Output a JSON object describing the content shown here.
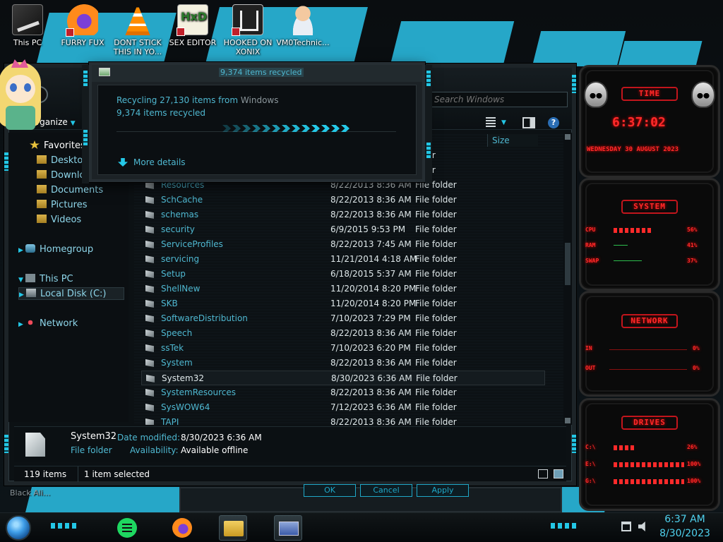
{
  "desktop": {
    "icons": [
      {
        "label": "This PC",
        "icon": "this-pc-icon"
      },
      {
        "label": "FURRY FUX",
        "icon": "firefox-icon"
      },
      {
        "label": "DONT STICK THIS IN YO...",
        "icon": "vlc-cone-icon"
      },
      {
        "label": "SEX EDITOR",
        "icon": "hxd-editor-icon"
      },
      {
        "label": "HOOKED ON XONIX",
        "icon": "game-icon"
      },
      {
        "label": "VM0Technic...",
        "icon": "doctor-avatar-icon"
      }
    ],
    "background_label": "Black Ali..."
  },
  "explorer": {
    "search_placeholder": "Search Windows",
    "organize_label": "Organize",
    "column_size_label": "Size",
    "nav": {
      "favorites": "Favorites",
      "desktop": "Desktop",
      "downloads": "Downloa...",
      "documents": "Documents",
      "pictures": "Pictures",
      "videos": "Videos",
      "homegroup": "Homegroup",
      "this_pc": "This PC",
      "local_disk": "Local Disk (C:)",
      "network": "Network"
    },
    "partial_rows": [
      "folder",
      "folder"
    ],
    "files": [
      {
        "name": "Resources",
        "date": "8/22/2013 8:36 AM",
        "type": "File folder"
      },
      {
        "name": "SchCache",
        "date": "8/22/2013 8:36 AM",
        "type": "File folder"
      },
      {
        "name": "schemas",
        "date": "8/22/2013 8:36 AM",
        "type": "File folder"
      },
      {
        "name": "security",
        "date": "6/9/2015 9:53 PM",
        "type": "File folder"
      },
      {
        "name": "ServiceProfiles",
        "date": "8/22/2013 7:45 AM",
        "type": "File folder"
      },
      {
        "name": "servicing",
        "date": "11/21/2014 4:18 AM",
        "type": "File folder"
      },
      {
        "name": "Setup",
        "date": "6/18/2015 5:37 AM",
        "type": "File folder"
      },
      {
        "name": "ShellNew",
        "date": "11/20/2014 8:20 PM",
        "type": "File folder"
      },
      {
        "name": "SKB",
        "date": "11/20/2014 8:20 PM",
        "type": "File folder"
      },
      {
        "name": "SoftwareDistribution",
        "date": "7/10/2023 7:29 PM",
        "type": "File folder"
      },
      {
        "name": "Speech",
        "date": "8/22/2013 8:36 AM",
        "type": "File folder"
      },
      {
        "name": "ssTek",
        "date": "7/10/2023 6:20 PM",
        "type": "File folder"
      },
      {
        "name": "System",
        "date": "8/22/2013 8:36 AM",
        "type": "File folder"
      },
      {
        "name": "System32",
        "date": "8/30/2023 6:36 AM",
        "type": "File folder",
        "selected": true
      },
      {
        "name": "SystemResources",
        "date": "8/22/2013 8:36 AM",
        "type": "File folder"
      },
      {
        "name": "SysWOW64",
        "date": "7/12/2023 6:36 AM",
        "type": "File folder"
      },
      {
        "name": "TAPI",
        "date": "8/22/2013 8:36 AM",
        "type": "File folder"
      }
    ],
    "details": {
      "name": "System32",
      "type": "File folder",
      "modified_label": "Date modified:",
      "modified_value": "8/30/2023 6:36 AM",
      "availability_label": "Availability:",
      "availability_value": "Available offline"
    },
    "status": {
      "item_count": "119 items",
      "selection": "1 item selected"
    }
  },
  "recycle_dialog": {
    "title": "9,374 items recycled",
    "line1_prefix": "Recycling 27,130 items from ",
    "line1_source": "Windows",
    "line2": "9,374 items recycled",
    "more_details": "More details"
  },
  "background_dialog": {
    "ok": "OK",
    "cancel": "Cancel",
    "apply": "Apply"
  },
  "gadgets": {
    "time": {
      "title": "TIME",
      "clock": "6:37:02",
      "date": "WEDNESDAY 30 AUGUST 2023"
    },
    "system": {
      "title": "SYSTEM",
      "rows": [
        {
          "label": "CPU",
          "value": "56%"
        },
        {
          "label": "RAM",
          "value": "41%"
        },
        {
          "label": "SWAP",
          "value": "37%"
        }
      ]
    },
    "network": {
      "title": "NETWORK",
      "rows": [
        {
          "label": "IN",
          "value": "0%"
        },
        {
          "label": "OUT",
          "value": "0%"
        }
      ]
    },
    "drives": {
      "title": "DRIVES",
      "rows": [
        {
          "label": "C:\\",
          "value": "26%"
        },
        {
          "label": "E:\\",
          "value": "100%"
        },
        {
          "label": "G:\\",
          "value": "100%"
        }
      ]
    }
  },
  "taskbar": {
    "time": "6:37 AM",
    "date": "8/30/2023"
  },
  "colors": {
    "accent_cyan": "#23c7e6",
    "link_blue": "#4fb8d1",
    "gadget_red": "#ff2a2a"
  }
}
